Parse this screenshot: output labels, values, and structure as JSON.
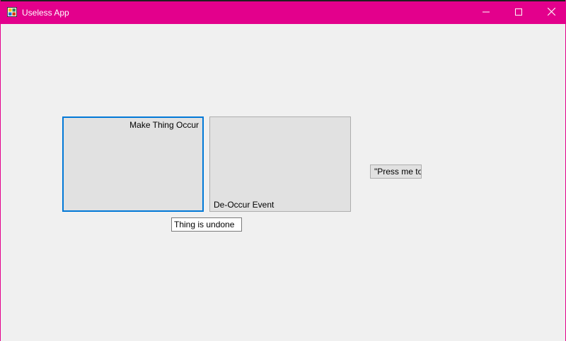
{
  "window": {
    "title": "Useless App",
    "accent_color": "#e3008c",
    "icons": {
      "app": "app-icon",
      "minimize": "minimize-icon",
      "maximize": "maximize-icon",
      "close": "close-icon"
    }
  },
  "buttons": {
    "make_thing_occur": "Make Thing Occur",
    "de_occur_event": "De-Occur Event",
    "press_me": "\"Press me to"
  },
  "status": {
    "value": "Thing is undone"
  }
}
